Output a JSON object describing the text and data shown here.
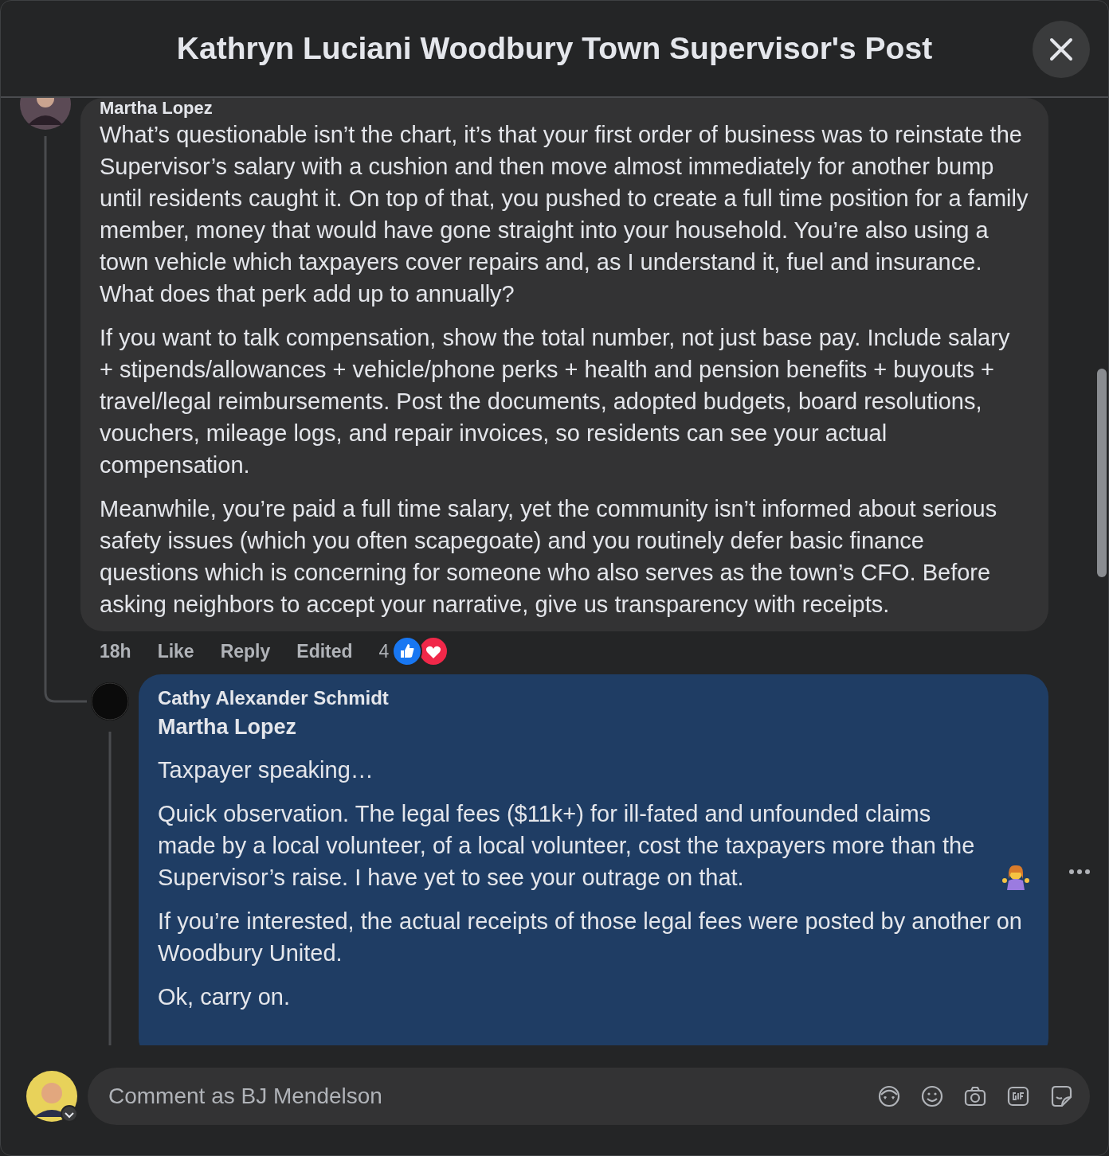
{
  "window": {
    "title": "Kathryn Luciani Woodbury Town Supervisor's Post"
  },
  "comments": [
    {
      "author": "Martha Lopez",
      "highlighted": false,
      "paragraphs": [
        "What’s questionable isn’t the chart, it’s that your first order of business was to reinstate the Supervisor’s salary with a cushion and then move almost immediately for another bump until residents caught it. On top of that, you pushed to create a full time position for a family member, money that would have gone straight into your household. You’re also using a town vehicle which taxpayers cover repairs and, as I understand it, fuel and insurance. What does that perk add up to annually?",
        "If you want to talk compensation, show the total number, not just base pay. Include salary + stipends/allowances + vehicle/phone perks + health and pension benefits + buyouts + travel/legal reimbursements. Post the documents, adopted budgets, board resolutions, vouchers, mileage logs, and repair invoices, so residents can see your actual compensation.",
        "Meanwhile, you’re paid a full time salary, yet the community isn’t informed about serious safety issues (which you often scapegoate) and you routinely defer basic finance questions which is concerning for someone who also serves as the town’s CFO. Before asking neighbors to accept your narrative, give us transparency with receipts."
      ],
      "time": "18h",
      "actions": [
        "Like",
        "Reply"
      ],
      "edited": "Edited",
      "reaction_count": "4"
    },
    {
      "author": "Cathy Alexander Schmidt",
      "mention": "Martha Lopez",
      "highlighted": true,
      "paragraphs": [
        "Taxpayer speaking…",
        "Quick observation. The legal fees ($11k+) for ill-fated and unfounded claims made by a local volunteer, of a local volunteer, cost the taxpayers more than the Supervisor’s raise. I have yet to see your outrage on that.",
        "If you’re interested, the actual receipts of those legal fees were posted by another on Woodbury United.",
        "Ok, carry on."
      ]
    }
  ],
  "composer": {
    "placeholder": "Comment as BJ Mendelson"
  }
}
